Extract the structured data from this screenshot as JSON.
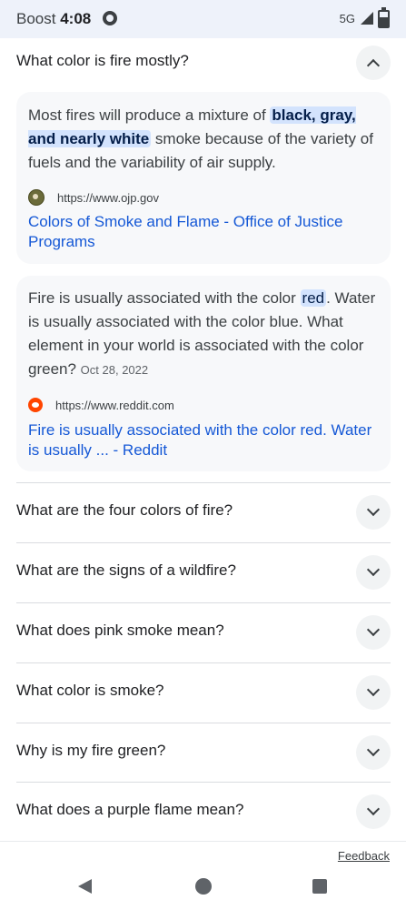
{
  "status_bar": {
    "carrier": "Boost",
    "time": "4:08",
    "network": "5G"
  },
  "expanded_question": {
    "label": "What color is fire mostly?"
  },
  "answers": [
    {
      "pre": "Most fires will produce a mixture of ",
      "highlight": "black, gray, and nearly white",
      "post": " smoke because of the variety of fuels and the variability of air supply.",
      "date": "",
      "source_url": "https://www.ojp.gov",
      "link_title": "Colors of Smoke and Flame - Office of Justice Programs"
    },
    {
      "pre": "Fire is usually associated with the color ",
      "highlight": "red",
      "post": ". Water is usually associated with the color blue. What element in your world is associated with the color green?",
      "date": "Oct 28, 2022",
      "source_url": "https://www.reddit.com",
      "link_title": "Fire is usually associated with the color red. Water is usually ... - Reddit"
    }
  ],
  "questions": [
    "What are the four colors of fire?",
    "What are the signs of a wildfire?",
    "What does pink smoke mean?",
    "What color is smoke?",
    "Why is my fire green?",
    "What does a purple flame mean?"
  ],
  "feedback_label": "Feedback",
  "icons": {
    "status": [
      "ghost-icon",
      "signal-icon",
      "battery-icon"
    ],
    "chevrons": [
      "chevron-up-icon",
      "chevron-down-icon"
    ],
    "nav": [
      "back-icon",
      "home-icon",
      "recents-icon"
    ],
    "favicons": [
      "ojp-favicon-icon",
      "reddit-favicon-icon"
    ]
  },
  "colors": {
    "link": "#1558d6",
    "highlight": "#d3e3fd",
    "card_bg": "#f7f8fa",
    "status_bg": "#eef2fa"
  }
}
